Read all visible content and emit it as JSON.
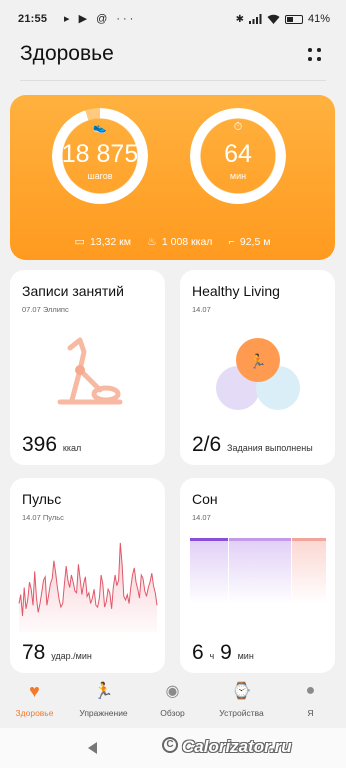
{
  "status_bar": {
    "time": "21:55",
    "icons": "▸ ▶ @ ···",
    "battery": "41%"
  },
  "header": {
    "title": "Здоровье"
  },
  "hero": {
    "steps": {
      "value": "18 875",
      "unit": "шагов",
      "icon": "shoe-icon",
      "progress": 0.95
    },
    "minutes": {
      "value": "64",
      "unit": "мин",
      "icon": "stopwatch-icon",
      "progress": 1.0
    },
    "stats": [
      {
        "icon": "ruler-icon",
        "text": "13,32 км"
      },
      {
        "icon": "flame-icon",
        "text": "1 008 ккал"
      },
      {
        "icon": "stairs-icon",
        "text": "92,5 м"
      }
    ]
  },
  "cards": {
    "workouts": {
      "title": "Записи занятий",
      "sub": "07.07 Эллипс",
      "value": "396",
      "unit": "ккал"
    },
    "healthy": {
      "title": "Healthy Living",
      "sub": "14.07",
      "value": "2/6",
      "unit": "Задания выполнены"
    },
    "pulse": {
      "title": "Пульс",
      "sub": "14.07 Пульс",
      "value": "78",
      "unit": "удар./мин",
      "series": [
        36,
        41,
        29,
        45,
        33,
        38,
        48,
        44,
        35,
        54,
        39,
        31,
        36,
        42,
        49,
        51,
        35,
        41,
        47,
        50,
        60,
        53,
        45,
        38,
        34,
        36,
        47,
        57,
        49,
        45,
        52,
        48,
        43,
        42,
        58,
        50,
        41,
        47,
        51,
        40,
        42,
        36,
        39,
        44,
        35,
        34,
        39,
        52,
        47,
        34,
        37,
        44,
        42,
        33,
        45,
        52,
        46,
        49,
        70,
        58,
        40,
        38,
        41,
        36,
        45,
        52,
        56,
        48,
        44,
        39,
        52,
        50,
        43,
        40,
        45,
        48,
        53,
        46,
        42,
        35
      ]
    },
    "sleep": {
      "title": "Сон",
      "sub": "14.07",
      "hours": "6",
      "h_unit": "ч",
      "minutes": "9",
      "m_unit": "мин"
    }
  },
  "tabs": [
    {
      "label": "Здоровье",
      "icon": "heart-pulse-icon",
      "active": true
    },
    {
      "label": "Упражнение",
      "icon": "runner-icon",
      "active": false
    },
    {
      "label": "Обзор",
      "icon": "globe-icon",
      "active": false
    },
    {
      "label": "Устройства",
      "icon": "watch-icon",
      "active": false
    },
    {
      "label": "Я",
      "icon": "person-icon",
      "active": false
    }
  ],
  "watermark": "Calorizator.ru",
  "colors": {
    "accent": "#f27a2a",
    "hero_bg": "#ffa52c",
    "pulse_line": "#e0586a",
    "sleep_deep": "#8a4fd8",
    "sleep_light": "#c49ae6",
    "sleep_rem": "#f2a59a"
  }
}
